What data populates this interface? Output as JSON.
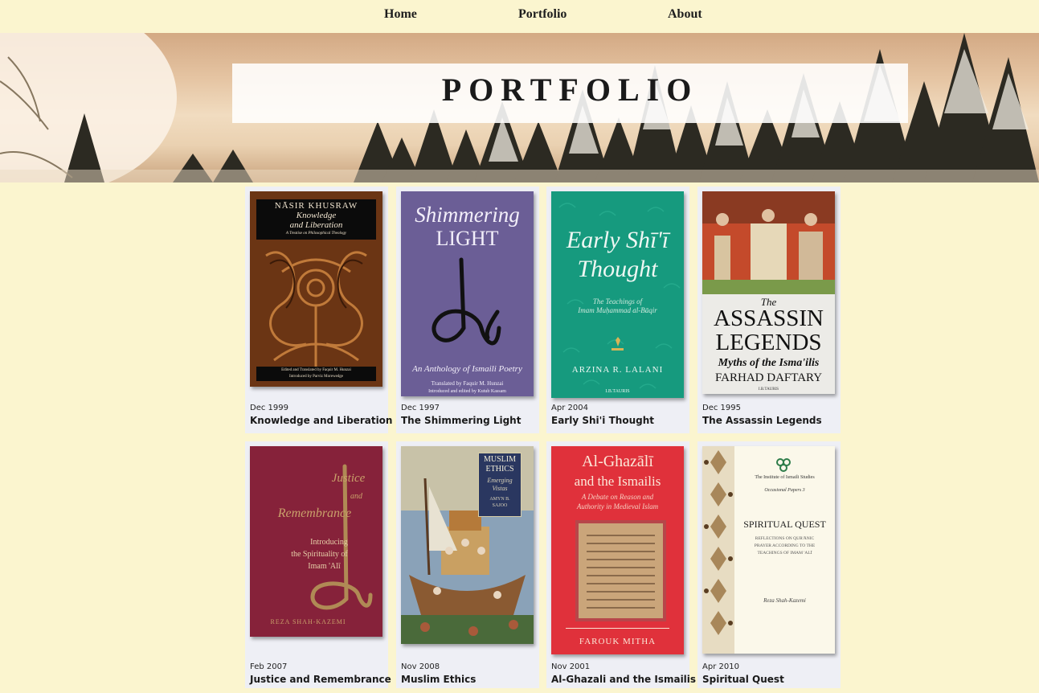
{
  "nav": {
    "items": [
      {
        "label": "Home"
      },
      {
        "label": "Portfolio"
      },
      {
        "label": "About"
      }
    ]
  },
  "hero": {
    "title": "PORTFOLIO"
  },
  "books": [
    {
      "date": "Dec 1999",
      "title": "Knowledge and Liberation",
      "cover": {
        "author": "NĀSIR KHUSRAW",
        "title_line1": "Knowledge",
        "title_line2": "and Liberation",
        "subtitle": "A Treatise on Philosophical Theology",
        "credit1": "Edited and Translated by Faquir M. Hunzai",
        "credit2": "Introduced by Parviz Morewedge"
      }
    },
    {
      "date": "Dec 1997",
      "title": "The Shimmering Light",
      "cover": {
        "title_line1": "Shimmering",
        "title_line2": "LIGHT",
        "subtitle": "An Anthology of Ismaili Poetry",
        "credit1": "Translated by Faquir M. Hunzai",
        "credit2": "Introduced and edited by Kutub Kassam"
      }
    },
    {
      "date": "Apr 2004",
      "title": "Early Shi'i Thought",
      "cover": {
        "title_line1": "Early Shī'ī",
        "title_line2": "Thought",
        "subtitle1": "The Teachings of",
        "subtitle2": "Imam Muḥammad al-Bāqir",
        "author": "ARZINA R. LALANI",
        "publisher": "I.B.TAURIS"
      }
    },
    {
      "date": "Dec 1995",
      "title": "The Assassin Legends",
      "cover": {
        "title_small": "The",
        "title_line1": "ASSASSIN",
        "title_line2": "LEGENDS",
        "subtitle": "Myths of the Isma'ilis",
        "author": "FARHAD DAFTARY",
        "publisher": "I.B.TAURIS"
      }
    },
    {
      "date": "Feb 2007",
      "title": "Justice and Remembrance",
      "cover": {
        "title_line1": "Justice",
        "title_line2": "and",
        "title_line3": "Remembrance",
        "subtitle1": "Introducing",
        "subtitle2": "the Spirituality of",
        "subtitle3": "Imam 'Alī",
        "author": "REZA SHAH-KAZEMI"
      }
    },
    {
      "date": "Nov 2008",
      "title": "Muslim Ethics",
      "cover": {
        "title_line1": "MUSLIM",
        "title_line2": "ETHICS",
        "subtitle1": "Emerging",
        "subtitle2": "Vistas",
        "author1": "AMYN B.",
        "author2": "SAJOO"
      }
    },
    {
      "date": "Nov 2001",
      "title": "Al-Ghazali and the Ismailis",
      "cover": {
        "title_line1": "Al-Ghazālī",
        "title_line2": "and the Ismailis",
        "subtitle1": "A Debate on Reason and",
        "subtitle2": "Authority in Medieval Islam",
        "author": "FAROUK MITHA"
      }
    },
    {
      "date": "Apr 2010",
      "title": "Spiritual Quest",
      "cover": {
        "institute": "The Institute of Ismaili Studies",
        "series": "Occasional Papers 3",
        "title": "SPIRITUAL QUEST",
        "subtitle1": "REFLECTIONS ON QUR'ĀNIC",
        "subtitle2": "PRAYER ACCORDING TO THE",
        "subtitle3": "TEACHINGS OF IMAM 'ALĪ",
        "author": "Reza Shah-Kazemi"
      }
    }
  ]
}
